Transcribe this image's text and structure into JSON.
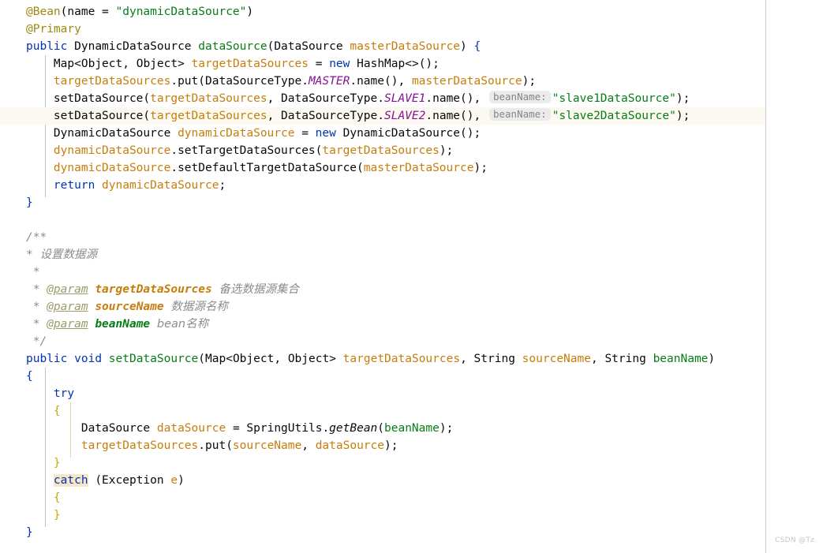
{
  "editor": {
    "language": "Java",
    "theme": "IntelliJ Light",
    "colors": {
      "background": "#ffffff",
      "caret_line": "#fcfaf0",
      "keyword": "#0033b3",
      "string": "#067d17",
      "annotation": "#9e880d",
      "static_field": "#871094",
      "parameter": "#c77d0a",
      "comment": "#8c8c8c",
      "inlay_hint_bg": "#ebebeb",
      "inlay_hint_text": "#858585",
      "highlight_word": "#f5e6c8",
      "indent_guide": "#b8c4cf",
      "indent_guide_warm": "#e3d9a8",
      "stripe_divider": "#c9c9c9",
      "watermark": "#c4c4c4"
    }
  },
  "watermark": {
    "text": "CSDN @Tz."
  },
  "code": {
    "lines": [
      {
        "n": 1,
        "text": "@Bean(name = \"dynamicDataSource\")"
      },
      {
        "n": 2,
        "text": "@Primary"
      },
      {
        "n": 3,
        "text": "public DynamicDataSource dataSource(DataSource masterDataSource) {"
      },
      {
        "n": 4,
        "text": "    Map<Object, Object> targetDataSources = new HashMap<>();"
      },
      {
        "n": 5,
        "text": "    targetDataSources.put(DataSourceType.MASTER.name(), masterDataSource);"
      },
      {
        "n": 6,
        "text": "    setDataSource(targetDataSources, DataSourceType.SLAVE1.name(), \"slave1DataSource\");"
      },
      {
        "n": 7,
        "text": "    setDataSource(targetDataSources, DataSourceType.SLAVE2.name(), \"slave2DataSource\");"
      },
      {
        "n": 8,
        "text": "    DynamicDataSource dynamicDataSource = new DynamicDataSource();"
      },
      {
        "n": 9,
        "text": "    dynamicDataSource.setTargetDataSources(targetDataSources);"
      },
      {
        "n": 10,
        "text": "    dynamicDataSource.setDefaultTargetDataSource(masterDataSource);"
      },
      {
        "n": 11,
        "text": "    return dynamicDataSource;"
      },
      {
        "n": 12,
        "text": "}"
      },
      {
        "n": 13,
        "text": ""
      },
      {
        "n": 14,
        "text": "/**"
      },
      {
        "n": 15,
        "text": " * 设置数据源"
      },
      {
        "n": 16,
        "text": " *"
      },
      {
        "n": 17,
        "text": " * @param targetDataSources 备选数据源集合"
      },
      {
        "n": 18,
        "text": " * @param sourceName 数据源名称"
      },
      {
        "n": 19,
        "text": " * @param beanName bean名称"
      },
      {
        "n": 20,
        "text": " */"
      },
      {
        "n": 21,
        "text": "public void setDataSource(Map<Object, Object> targetDataSources, String sourceName, String beanName)"
      },
      {
        "n": 22,
        "text": "{"
      },
      {
        "n": 23,
        "text": "    try"
      },
      {
        "n": 24,
        "text": "    {"
      },
      {
        "n": 25,
        "text": "        DataSource dataSource = SpringUtils.getBean(beanName);"
      },
      {
        "n": 26,
        "text": "        targetDataSources.put(sourceName, dataSource);"
      },
      {
        "n": 27,
        "text": "    }"
      },
      {
        "n": 28,
        "text": "    catch (Exception e)"
      },
      {
        "n": 29,
        "text": "    {"
      },
      {
        "n": 30,
        "text": "    }"
      },
      {
        "n": 31,
        "text": "}"
      }
    ]
  },
  "tokens": {
    "l1": {
      "anno": "@Bean",
      "p_open": "(",
      "name": "name",
      "eq": " = ",
      "str": "\"dynamicDataSource\"",
      "p_close": ")"
    },
    "l2": {
      "anno": "@Primary"
    },
    "l3": {
      "kw": "public",
      "ret": "DynamicDataSource",
      "method": "dataSource",
      "ptype": "DataSource",
      "pname": "masterDataSource",
      "brace": "{"
    },
    "l4": {
      "map": "Map",
      "lt": "<",
      "o1": "Object",
      "comma": ", ",
      "o2": "Object",
      "gt": ">",
      "var": "targetDataSources",
      "eq": " = ",
      "kw": "new",
      "cls": "HashMap",
      "diamond": "<>();"
    },
    "l5": {
      "var": "targetDataSources",
      "dot": ".",
      "m": "put",
      "cls": "DataSourceType",
      "const": "MASTER",
      "namecall": "name()",
      "arg": "masterDataSource"
    },
    "l6": {
      "m": "setDataSource",
      "a1": "targetDataSources",
      "cls": "DataSourceType",
      "const": "SLAVE1",
      "namecall": "name()",
      "hint": "beanName:",
      "str": "\"slave1DataSource\""
    },
    "l7": {
      "m": "setDataSource",
      "a1": "targetDataSources",
      "cls": "DataSourceType",
      "const": "SLAVE2",
      "namecall": "name()",
      "hint": "beanName:",
      "str": "\"slave2DataSource\""
    },
    "l8": {
      "cls": "DynamicDataSource",
      "var": "dynamicDataSource",
      "kw": "new",
      "ctor": "DynamicDataSource"
    },
    "l9": {
      "var": "dynamicDataSource",
      "m": "setTargetDataSources",
      "arg": "targetDataSources"
    },
    "l10": {
      "var": "dynamicDataSource",
      "m": "setDefaultTargetDataSource",
      "arg": "masterDataSource"
    },
    "l11": {
      "kw": "return",
      "var": "dynamicDataSource"
    },
    "l15": {
      "star": "*",
      "cn": "设置数据源"
    },
    "l17": {
      "star": "*",
      "tag": "@param",
      "name": "targetDataSources",
      "cn": "备选数据源集合"
    },
    "l18": {
      "star": "*",
      "tag": "@param",
      "name": "sourceName",
      "cn": "数据源名称"
    },
    "l19": {
      "star": "*",
      "tag": "@param",
      "name": "beanName",
      "cn": "bean名称"
    },
    "l21": {
      "kw1": "public",
      "kw2": "void",
      "method": "setDataSource",
      "map": "Map",
      "o1": "Object",
      "o2": "Object",
      "p1": "targetDataSources",
      "s1": "String",
      "p2": "sourceName",
      "s2": "String",
      "p3": "beanName"
    },
    "l23": {
      "kw": "try"
    },
    "l25": {
      "cls": "DataSource",
      "var": "dataSource",
      "util": "SpringUtils",
      "m": "getBean",
      "arg": "beanName"
    },
    "l26": {
      "var": "targetDataSources",
      "m": "put",
      "a1": "sourceName",
      "a2": "dataSource"
    },
    "l28": {
      "kw": "catch",
      "ex": "Exception",
      "var": "e"
    }
  }
}
